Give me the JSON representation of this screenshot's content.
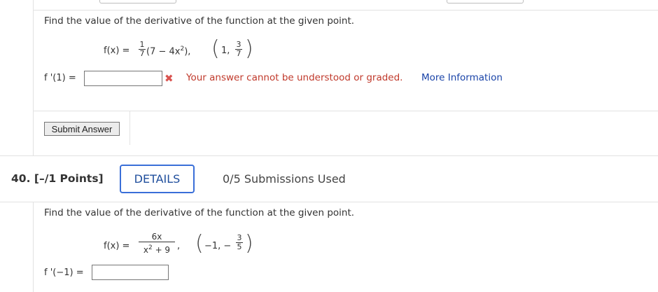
{
  "q39": {
    "prompt": "Find the value of the derivative of the function at the given point.",
    "func_lhs": "f(x) =",
    "frac1_num": "1",
    "frac1_den": "7",
    "func_rest_a": "(7 − 4x",
    "func_rest_exp": "2",
    "func_rest_b": "),",
    "point_prefix": "1,",
    "point_frac_num": "3",
    "point_frac_den": "7",
    "answer_label": "f '(1) =",
    "answer_value": "",
    "error_icon": "✖",
    "error_text": "Your answer cannot be understood or graded.",
    "more_info": "More Information",
    "submit_label": "Submit Answer"
  },
  "q40": {
    "number": "40.",
    "points": "[–/1 Points]",
    "details_label": "DETAILS",
    "submissions": "0/5 Submissions Used",
    "prompt": "Find the value of the derivative of the function at the given point.",
    "func_lhs": "f(x) =",
    "frac_num": "6x",
    "frac_den_a": "x",
    "frac_den_exp": "2",
    "frac_den_b": " + 9",
    "comma": ",",
    "point_prefix": "−1, −",
    "point_frac_num": "3",
    "point_frac_den": "5",
    "answer_label": "f '(−1) =",
    "answer_value": ""
  },
  "icons": {
    "error": "x-mark-icon"
  },
  "colors": {
    "error": "#c0392b",
    "link": "#1a44a8",
    "details_border": "#3a6fd8"
  }
}
